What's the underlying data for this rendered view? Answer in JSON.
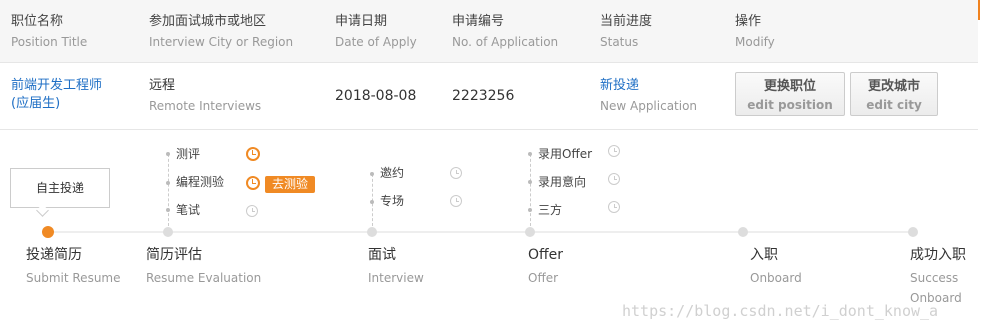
{
  "header": {
    "columns": [
      {
        "cn": "职位名称",
        "en": "Position Title"
      },
      {
        "cn": "参加面试城市或地区",
        "en": "Interview City or Region"
      },
      {
        "cn": "申请日期",
        "en": "Date of Apply"
      },
      {
        "cn": "申请编号",
        "en": "No. of Application"
      },
      {
        "cn": "当前进度",
        "en": "Status"
      },
      {
        "cn": "操作",
        "en": "Modify"
      }
    ]
  },
  "application": {
    "position_line1": "前端开发工程师",
    "position_line2": "(应届生)",
    "city_cn": "远程",
    "city_en": "Remote Interviews",
    "date": "2018-08-08",
    "number": "2223256",
    "status_cn": "新投递",
    "status_en": "New Application",
    "change_position_cn": "更换职位",
    "change_position_en": "edit position",
    "change_city_cn": "更改城市",
    "change_city_en": "edit city"
  },
  "timeline": {
    "tooltip": "自主投递",
    "stages": [
      {
        "cn": "投递简历",
        "en": "Submit Resume"
      },
      {
        "cn": "简历评估",
        "en": "Resume Evaluation"
      },
      {
        "cn": "面试",
        "en": "Interview"
      },
      {
        "cn": "Offer",
        "en": "Offer"
      },
      {
        "cn": "入职",
        "en": "Onboard"
      },
      {
        "cn": "成功入职",
        "en": "Success",
        "en2": "Onboard"
      }
    ],
    "evaluation_steps": [
      "测评",
      "编程测验",
      "笔试"
    ],
    "test_button": "去测验",
    "interview_steps": [
      "邀约",
      "专场"
    ],
    "offer_steps": [
      "录用Offer",
      "录用意向",
      "三方"
    ]
  },
  "watermark": "https://blog.csdn.net/i_dont_know_a",
  "colors": {
    "accent": "#f08a24",
    "link": "#1f6fc5"
  }
}
